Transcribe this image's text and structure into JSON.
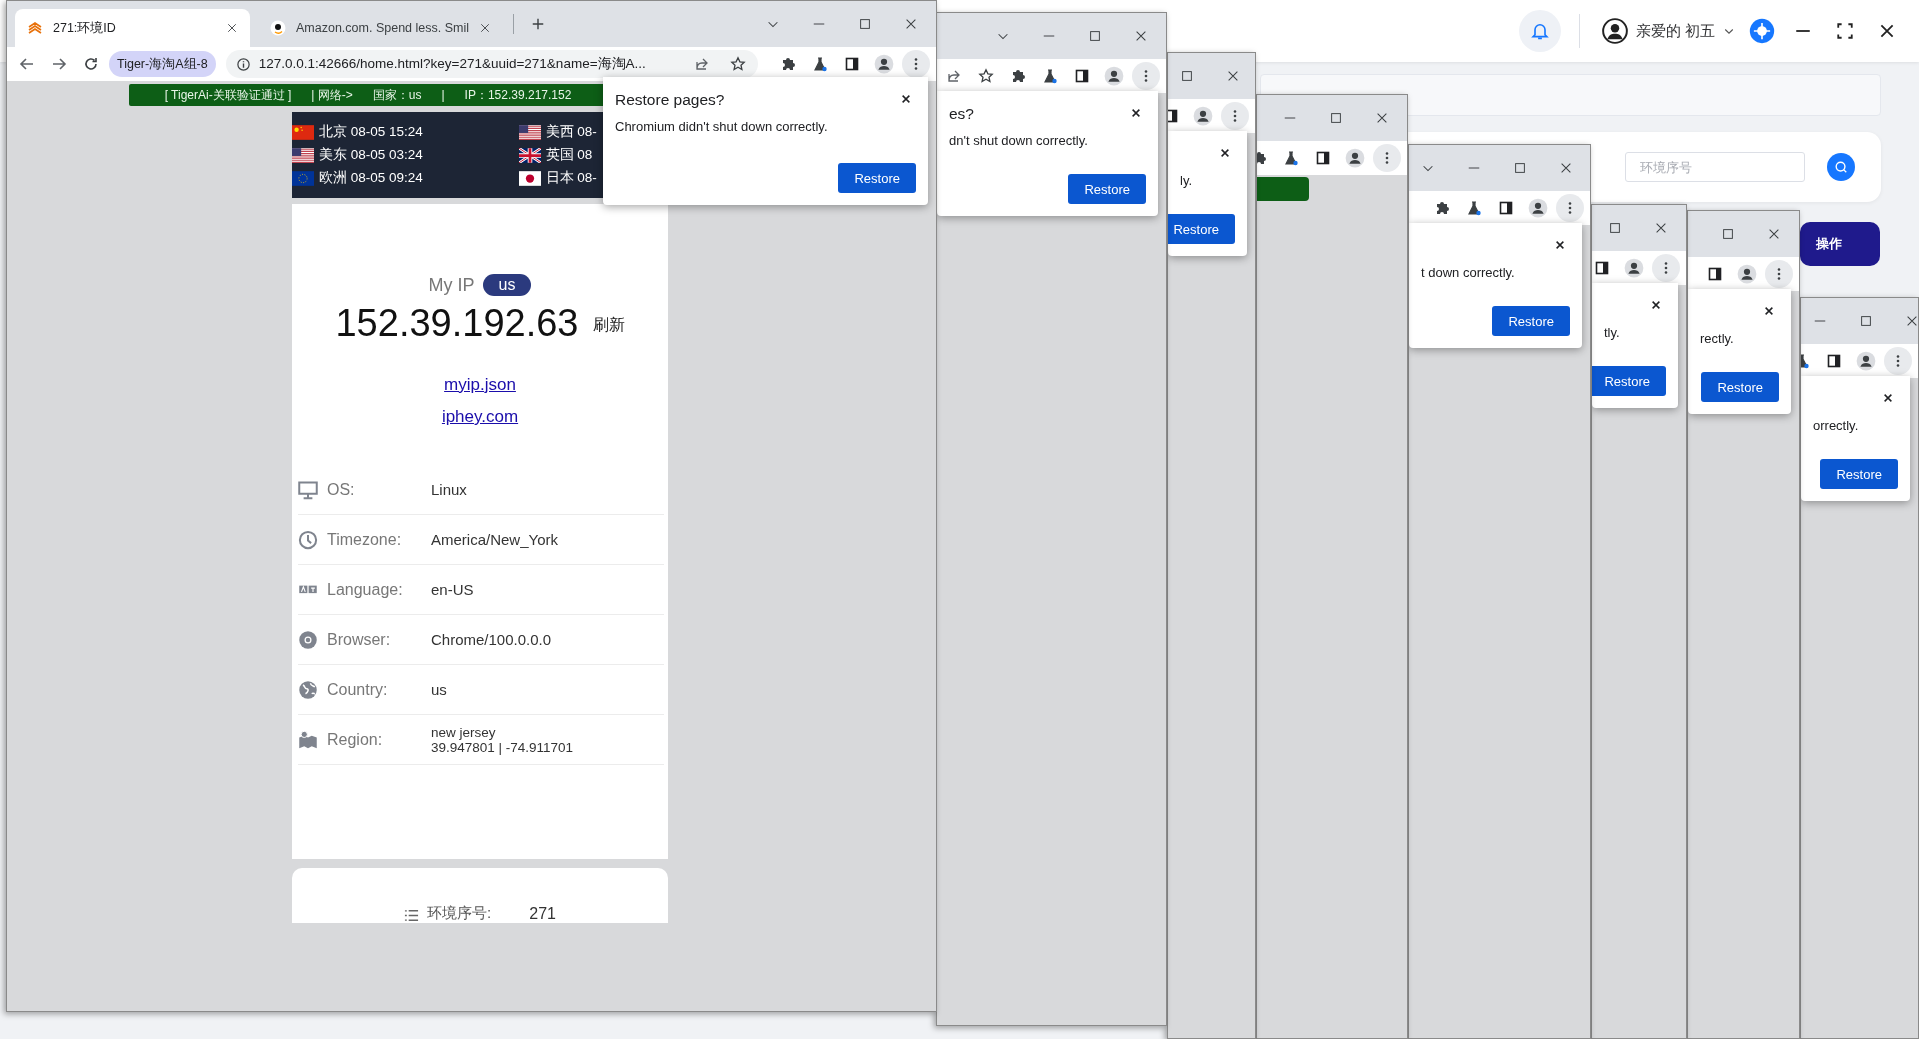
{
  "app": {
    "user": "亲爱的 初五",
    "search_placeholder": "环境序号",
    "column_header": "操作"
  },
  "main_window": {
    "tabs": [
      {
        "title": "271:环境ID",
        "selected": true
      },
      {
        "title": "Amazon.com. Spend less. Smil",
        "selected": false
      }
    ],
    "profile": "Tiger-海淘A组-8",
    "url": "127.0.0.1:42666/home.html?key=271&uuid=271&name=海淘A...",
    "banner": [
      "[ TigerAi-关联验证通过 ]",
      "| 网络->",
      "国家：us",
      "|",
      "IP：152.39.217.152"
    ],
    "clocks": [
      {
        "kind": "cn",
        "text": "北京 08-05 15:24"
      },
      {
        "kind": "us",
        "text": "美西 08-"
      },
      {
        "kind": "us",
        "text": "美东 08-05 03:24"
      },
      {
        "kind": "uk",
        "text": "英国 08"
      },
      {
        "kind": "eu",
        "text": "欧洲 08-05 09:24"
      },
      {
        "kind": "jp",
        "text": "日本 08-"
      }
    ],
    "my_ip_label": "My IP",
    "country_badge": "us",
    "ip": "152.39.192.63",
    "refresh": "刷新",
    "links": [
      "myip.json",
      "iphey.com"
    ],
    "info": [
      {
        "kind": "os",
        "label": "OS:",
        "value": "Linux"
      },
      {
        "kind": "timezone",
        "label": "Timezone:",
        "value": "America/New_York"
      },
      {
        "kind": "language",
        "label": "Language:",
        "value": "en-US"
      },
      {
        "kind": "browser",
        "label": "Browser:",
        "value": "Chrome/100.0.0.0"
      },
      {
        "kind": "country",
        "label": "Country:",
        "value": "us"
      },
      {
        "kind": "region",
        "label": "Region:",
        "value": "new jersey",
        "value_2": "39.947801 | -74.911701"
      }
    ],
    "env": {
      "label": "环境序号:",
      "value": "271"
    }
  },
  "restore_dialog": {
    "title": "Restore pages?",
    "message": "Chromium didn't shut down correctly.",
    "button": "Restore"
  },
  "background_windows": [
    {
      "kind": "dialog",
      "title": "es?",
      "message": "dn't shut down correctly.",
      "button": "Restore"
    },
    {
      "kind": "dialog",
      "message": "ly.",
      "button": "Restore"
    },
    {
      "kind": "banner"
    },
    {
      "kind": "dialog",
      "message": "t down correctly.",
      "button": "Restore"
    },
    {
      "kind": "dialog",
      "message": "tly.",
      "button": "Restore"
    },
    {
      "kind": "dialog",
      "message": "rectly.",
      "button": "Restore"
    },
    {
      "kind": "dialog",
      "message": "orrectly.",
      "button": "Restore"
    }
  ]
}
